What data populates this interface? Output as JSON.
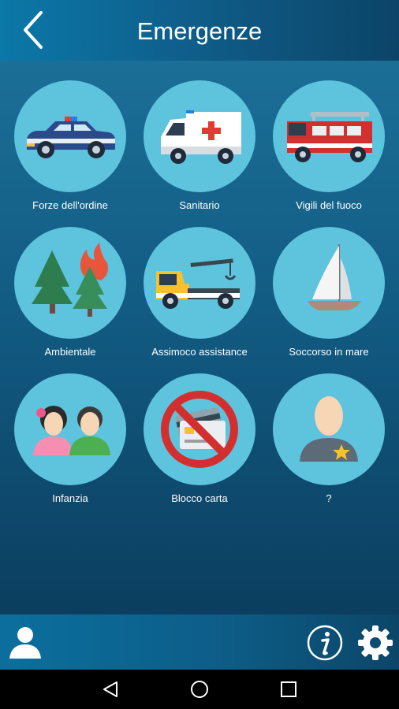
{
  "header": {
    "title": "Emergenze"
  },
  "tiles": [
    {
      "label": "Forze dell'ordine",
      "icon": "police-car-icon"
    },
    {
      "label": "Sanitario",
      "icon": "ambulance-icon"
    },
    {
      "label": "Vigili del fuoco",
      "icon": "fire-truck-icon"
    },
    {
      "label": "Ambientale",
      "icon": "forest-fire-icon"
    },
    {
      "label": "Assimoco assistance",
      "icon": "tow-truck-icon"
    },
    {
      "label": "Soccorso in mare",
      "icon": "sailboat-icon"
    },
    {
      "label": "Infanzia",
      "icon": "children-icon"
    },
    {
      "label": "Blocco carta",
      "icon": "card-block-icon"
    },
    {
      "label": "?",
      "icon": "officer-icon"
    }
  ],
  "bottom_bar": {
    "profile": "user-icon",
    "info": "info-icon",
    "settings": "gear-icon"
  },
  "colors": {
    "accent": "#5ec3dd",
    "header": "#0b78a8",
    "background": "#0d4f74"
  }
}
